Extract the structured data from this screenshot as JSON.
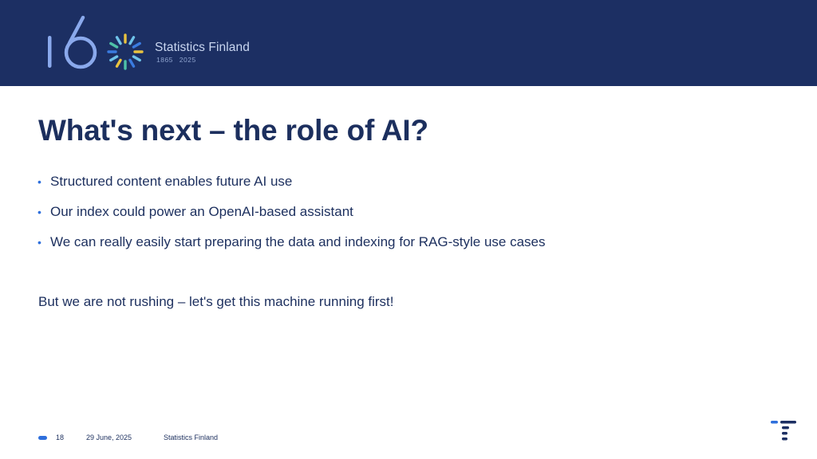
{
  "header": {
    "brand_name": "Statistics Finland",
    "years": "1865 2025",
    "logo": "160-years-anniversary-logo"
  },
  "slide": {
    "title": "What's next – the role of AI?",
    "bullets": [
      "Structured content enables future AI use",
      "Our index could power an OpenAI-based assistant",
      "We can really easily start preparing the data and indexing for RAG-style use cases"
    ],
    "closing": "But we are not rushing – let's get this machine running first!"
  },
  "footer": {
    "page_number": "18",
    "date": "29 June, 2025",
    "organization": "Statistics Finland",
    "mini_logo": "statistics-finland-logo-icon"
  },
  "colors": {
    "header_bg": "#1c2f63",
    "text": "#1c2f5e",
    "accent": "#2e6fdc"
  }
}
